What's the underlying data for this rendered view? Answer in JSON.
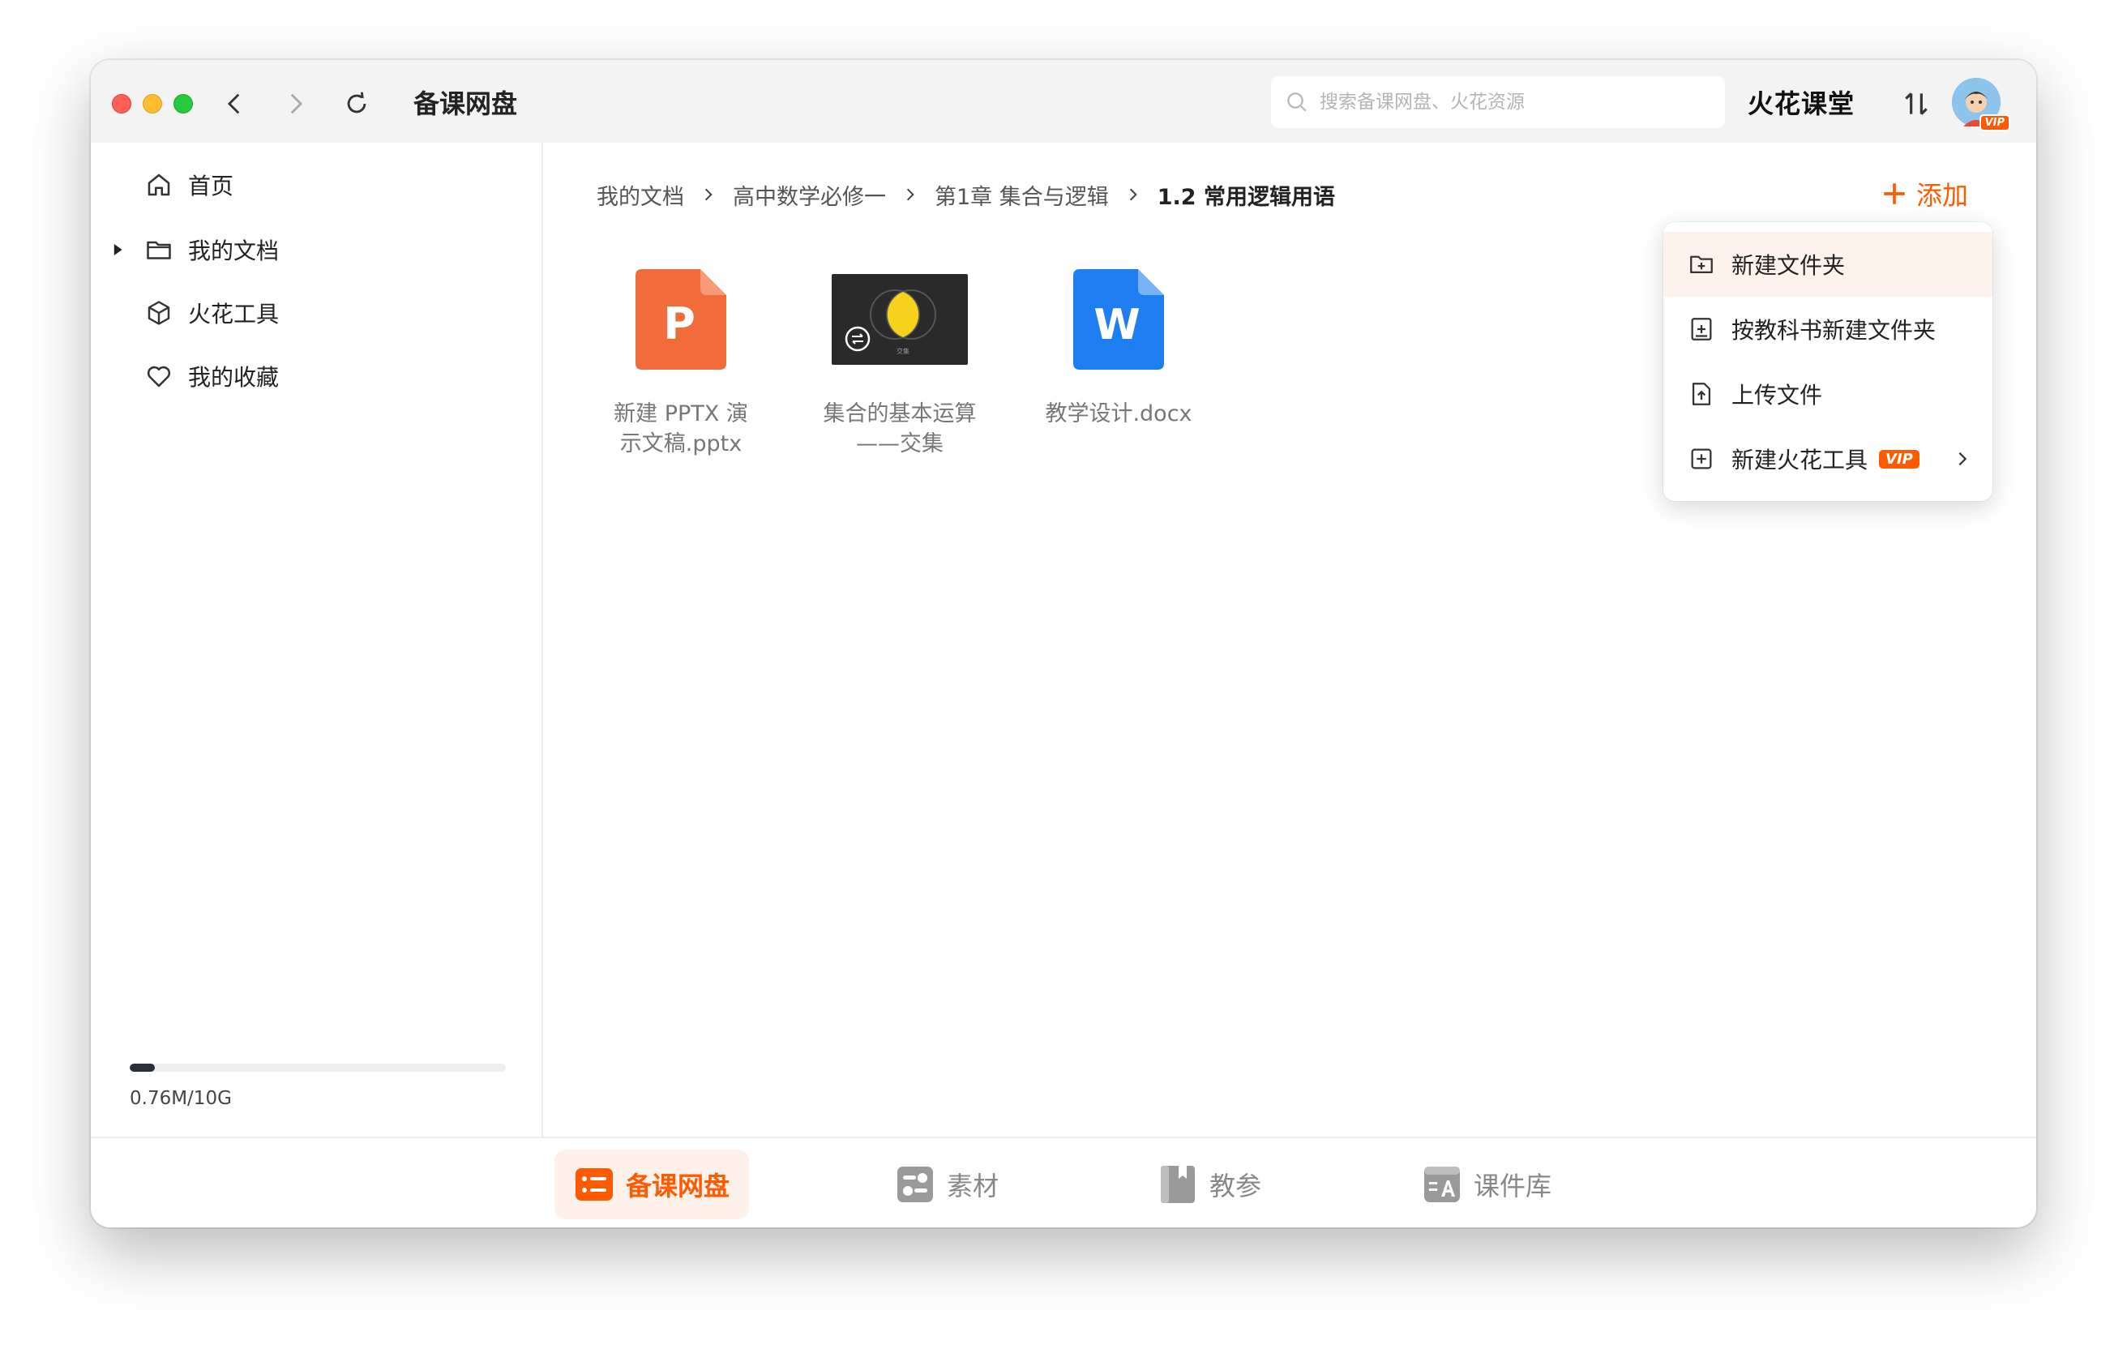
{
  "colors": {
    "accent": "#ff5a00",
    "ppt": "#f26b3a",
    "word": "#1f7ff0"
  },
  "titlebar": {
    "app_title": "备课网盘",
    "search_placeholder": "搜索备课网盘、火花资源",
    "brand": "火花课堂",
    "avatar_badge": "VIP"
  },
  "sidebar": {
    "items": [
      {
        "label": "首页",
        "icon": "home-icon"
      },
      {
        "label": "我的文档",
        "icon": "folder-icon"
      },
      {
        "label": "火花工具",
        "icon": "cube-icon"
      },
      {
        "label": "我的收藏",
        "icon": "heart-icon"
      }
    ],
    "storage": {
      "text": "0.76M/10G",
      "used_fraction": 0.066
    }
  },
  "breadcrumb": [
    "我的文档",
    "高中数学必修一",
    "第1章 集合与逻辑",
    "1.2 常用逻辑用语"
  ],
  "add_button": "添加",
  "files": [
    {
      "name_line1": "新建 PPTX 演",
      "name_line2": "示文稿.pptx",
      "type": "pptx",
      "icon_letter": "P"
    },
    {
      "name_line1": "集合的基本运算",
      "name_line2": "——交集",
      "type": "spark-tool",
      "thumb_caption": "交集"
    },
    {
      "name_line1": "教学设计.docx",
      "name_line2": "",
      "type": "docx",
      "icon_letter": "W"
    }
  ],
  "dropdown": [
    {
      "label": "新建文件夹",
      "icon": "folder-plus-icon"
    },
    {
      "label": "按教科书新建文件夹",
      "icon": "book-plus-icon"
    },
    {
      "label": "上传文件",
      "icon": "upload-file-icon"
    },
    {
      "label": "新建火花工具",
      "icon": "add-square-icon",
      "badge": "VIP"
    }
  ],
  "bottom_tabs": [
    {
      "label": "备课网盘",
      "icon": "list-icon",
      "active": true
    },
    {
      "label": "素材",
      "icon": "material-icon"
    },
    {
      "label": "教参",
      "icon": "book-icon"
    },
    {
      "label": "课件库",
      "icon": "courseware-icon"
    }
  ]
}
